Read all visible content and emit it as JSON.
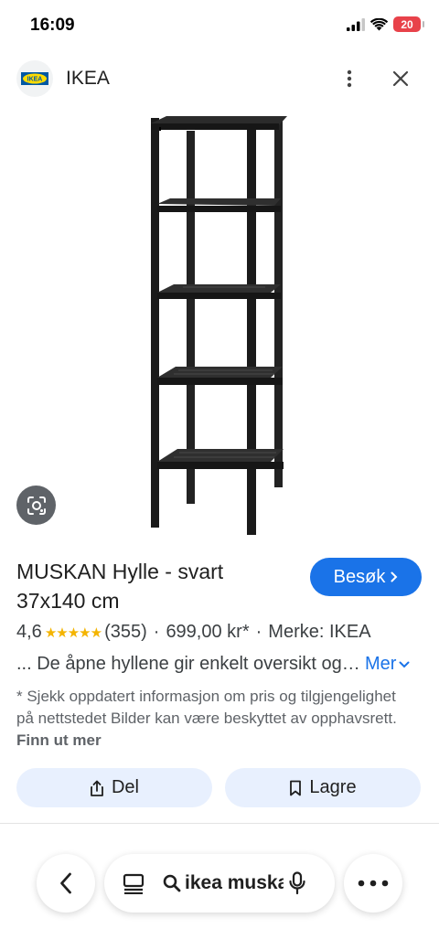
{
  "status_bar": {
    "time": "16:09",
    "battery_level": "20",
    "icons": [
      "signal-icon",
      "wifi-icon",
      "battery-icon"
    ]
  },
  "header": {
    "site_name": "IKEA",
    "logo_text": "IKEA",
    "icons": [
      "more-vertical-icon",
      "close-icon"
    ]
  },
  "product": {
    "title": "MUSKAN Hylle - svart 37x140 cm",
    "visit_label": "Besøk",
    "rating": "4,6",
    "stars": "★★★★★",
    "review_count": "(355)",
    "separator_1": "·",
    "price": "699,00 kr*",
    "separator_2": "·",
    "brand": "Merke: IKEA",
    "description": "... De åpne hyllene gir enkelt oversikt og tilgang",
    "more_label": "Mer",
    "disclaimer": "* Sjekk oppdatert informasjon om pris og tilgjengelighet på nettstedet Bilder kan være beskyttet av opphavsrett.",
    "learn_more": "Finn ut mer"
  },
  "actions": {
    "share_label": "Del",
    "save_label": "Lagre"
  },
  "bottom_bar": {
    "search_query": "ikea muskan hylle",
    "icons": [
      "back-icon",
      "tabs-icon",
      "search-icon",
      "mic-icon",
      "more-horizontal-icon"
    ]
  },
  "colors": {
    "accent": "#1a73e8",
    "action_bg": "#e8f0fe",
    "star": "#f4b400",
    "battery": "#e8424a",
    "ikea_blue": "#0058a3",
    "ikea_yellow": "#ffdb00"
  }
}
